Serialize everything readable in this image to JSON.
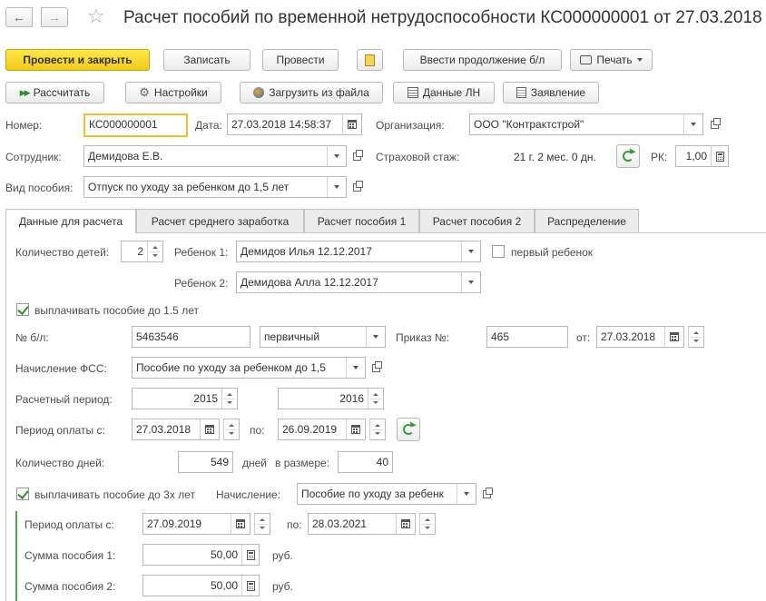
{
  "window": {
    "title": "Расчет пособий по временной нетрудоспособности КС000000001 от 27.03.2018"
  },
  "toolbar1": {
    "post_close": "Провести и закрыть",
    "save": "Записать",
    "post": "Провести",
    "continue_sick": "Ввести продолжение б/л",
    "print": "Печать"
  },
  "toolbar2": {
    "calculate": "Рассчитать",
    "settings": "Настройки",
    "load_file": "Загрузить из файла",
    "ln_data": "Данные ЛН",
    "application": "Заявление"
  },
  "header": {
    "number_label": "Номер:",
    "number": "КС000000001",
    "date_label": "Дата:",
    "date": "27.03.2018 14:58:37",
    "org_label": "Организация:",
    "org": "ООО \"Контрактстрой\"",
    "employee_label": "Сотрудник:",
    "employee": "Демидова Е.В.",
    "insurance_label": "Страховой стаж:",
    "insurance": "21 г. 2 мес. 0 дн.",
    "rk_label": "РК:",
    "rk": "1,00",
    "benefit_label": "Вид пособия:",
    "benefit": "Отпуск по уходу за ребенком до 1,5 лет"
  },
  "tabs": [
    {
      "label": "Данные для расчета"
    },
    {
      "label": "Расчет среднего заработка"
    },
    {
      "label": "Расчет пособия 1"
    },
    {
      "label": "Расчет пособия 2"
    },
    {
      "label": "Распределение"
    }
  ],
  "form": {
    "children_label": "Количество детей:",
    "children": "2",
    "child1_label": "Ребенок 1:",
    "child1": "Демидов Илья 12.12.2017",
    "first_child_label": "первый ребенок",
    "child2_label": "Ребенок 2:",
    "child2": "Демидова Алла 12.12.2017",
    "pay15_label": "выплачивать пособие до 1.5 лет",
    "sick_no_label": "№ б/л:",
    "sick_no": "5463546",
    "sick_type": "первичный",
    "order_label": "Приказ №:",
    "order_no": "465",
    "order_from_label": "от:",
    "order_date": "27.03.2018",
    "fss_label": "Начисление ФСС:",
    "fss": "Пособие по уходу за ребенком до 1,5",
    "calc_period_label": "Расчетный период:",
    "year1": "2015",
    "year2": "2016",
    "pay_period_label": "Период оплаты с:",
    "pay_from": "27.03.2018",
    "pay_to_label": "по:",
    "pay_to": "26.09.2019",
    "days_label": "Количество дней:",
    "days": "549",
    "days_unit_label": "дней",
    "size_label": "в размере:",
    "size": "40",
    "pay3_label": "выплачивать пособие до 3х лет",
    "accrual_label": "Начисление:",
    "accrual": "Пособие по уходу за ребенк",
    "pay3_from_label": "Период оплаты с:",
    "pay3_from": "27.09.2019",
    "pay3_to_label": "по:",
    "pay3_to": "28.03.2021",
    "sum1_label": "Сумма пособия 1:",
    "sum1": "50,00",
    "sum1_unit": "руб.",
    "sum2_label": "Сумма пособия 2:",
    "sum2": "50,00",
    "sum2_unit": "руб."
  }
}
